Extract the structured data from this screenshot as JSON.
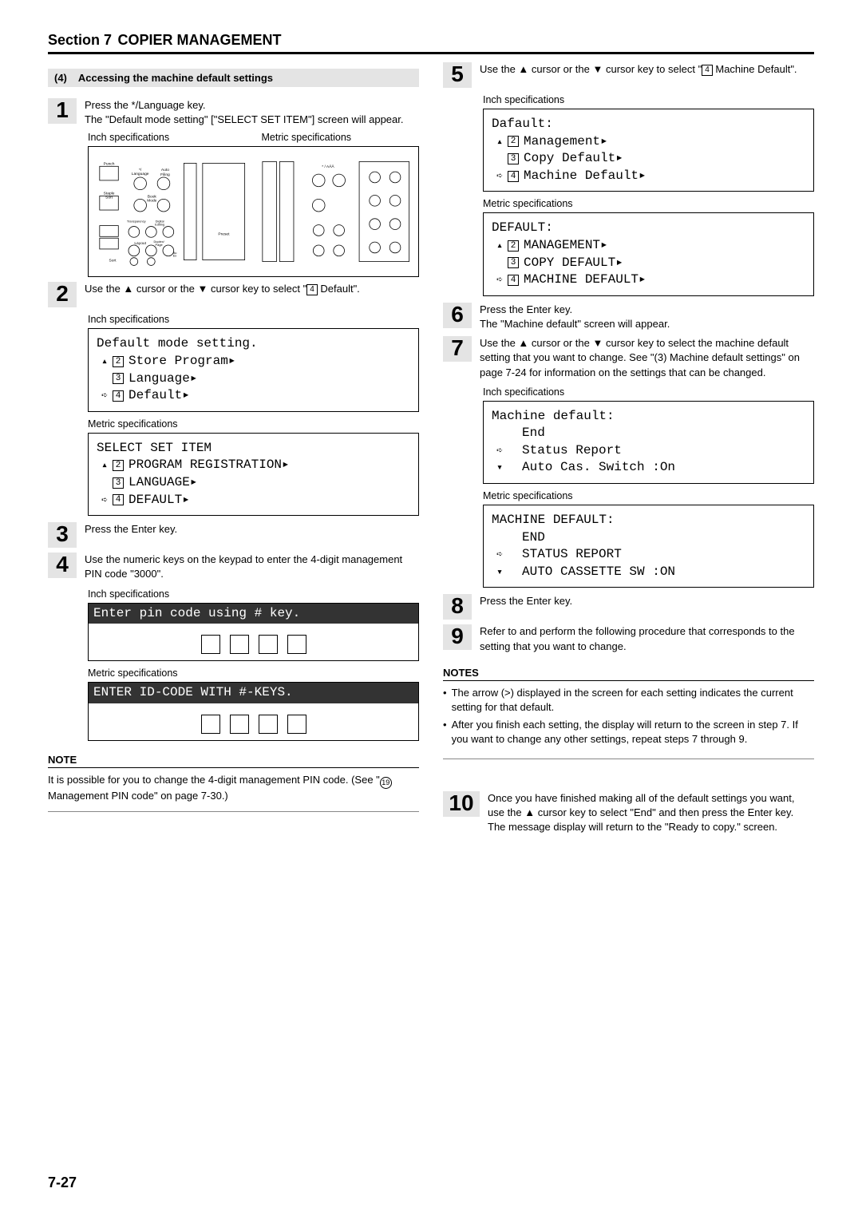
{
  "header": {
    "section_label": "Section 7",
    "section_title": "COPIER MANAGEMENT"
  },
  "subheading": {
    "num": "(4)",
    "text": "Accessing the machine default settings"
  },
  "inch_label": "Inch specifications",
  "metric_label": "Metric specifications",
  "steps": {
    "s1": {
      "num": "1",
      "l1": "Press the */Language key.",
      "l2": "The \"Default mode setting\" [\"SELECT SET ITEM\"] screen will appear."
    },
    "s2": {
      "num": "2",
      "text_a": "Use the ",
      "text_b": " cursor or the ",
      "text_c": " cursor key to select \"",
      "text_d": " Default\".",
      "box4": "4"
    },
    "s3": {
      "num": "3",
      "text": "Press the Enter key."
    },
    "s4": {
      "num": "4",
      "text": "Use the numeric keys on the keypad to enter the 4-digit management PIN code \"3000\"."
    },
    "s5": {
      "num": "5",
      "text_a": "Use the ",
      "text_b": " cursor or the ",
      "text_c": " cursor key to select \"",
      "text_d": " Machine Default\".",
      "box4": "4"
    },
    "s6": {
      "num": "6",
      "l1": "Press the Enter key.",
      "l2": "The \"Machine default\" screen will appear."
    },
    "s7": {
      "num": "7",
      "text_a": "Use the ",
      "text_b": " cursor or the ",
      "text_c": " cursor key to select the machine default setting that you want to change. See \"(3) Machine default settings\" on page 7-24 for information on the settings that can be changed."
    },
    "s8": {
      "num": "8",
      "text": "Press the Enter key."
    },
    "s9": {
      "num": "9",
      "text": "Refer to and perform the following procedure that corresponds to the setting that you want to change."
    },
    "s10": {
      "num": "10",
      "l1": "Once you have finished making all of the default settings you want, use the ",
      "l1b": " cursor key to select \"End\" and then press the Enter key.",
      "l2": "The message display will return to the \"Ready to copy.\" screen."
    }
  },
  "lcd": {
    "default_mode_inch": {
      "title": "Default mode setting.",
      "i2": "Store Program",
      "i3": "Language",
      "i4": "Default"
    },
    "default_mode_metric": {
      "title": "SELECT SET ITEM",
      "i2": "PROGRAM REGISTRATION",
      "i3": "LANGUAGE",
      "i4": "DEFAULT"
    },
    "pin_inch": "Enter pin code using # key.",
    "pin_metric": "ENTER ID-CODE WITH #-KEYS.",
    "def_inch": {
      "title": "Dafault:",
      "i2": "Management",
      "i3": "Copy Default",
      "i4": "Machine Default"
    },
    "def_metric": {
      "title": "DEFAULT:",
      "i2": "MANAGEMENT",
      "i3": "COPY DEFAULT",
      "i4": "MACHINE DEFAULT"
    },
    "mach_inch": {
      "title": "Machine default:",
      "i1": "End",
      "i2": "Status Report",
      "i3": "Auto Cas. Switch :On"
    },
    "mach_metric": {
      "title": "MACHINE DEFAULT:",
      "i1": "END",
      "i2": "STATUS REPORT",
      "i3": "AUTO CASSETTE SW :ON"
    }
  },
  "note1": {
    "heading": "NOTE",
    "text_a": "It is possible for you to change the 4-digit management PIN code. (See \"",
    "circle": "19",
    "text_b": " Management PIN code\" on page 7-30.)"
  },
  "notes2": {
    "heading": "NOTES",
    "b1": "The arrow (>) displayed in the screen for each setting indicates the current setting for that default.",
    "b2": "After you finish each setting, the display will return to the screen in step 7. If you want to change any other settings, repeat steps 7 through 9."
  },
  "panel_labels": {
    "punch": "Punch",
    "lang": "*/\nLanguage",
    "auto": "Auto\nSelection/\nFiling",
    "book": "Book\nMode",
    "staple": "Staple\nSort",
    "trans": "Transparency\nFilm/\nCard Stock",
    "digital": "Digital\nEditing",
    "preset": "Preset",
    "layout": "Layout",
    "duplex": "Duplex/\nPage\nSeparation",
    "auex": "Au\nEx",
    "sort": "Sort",
    "aaa": "* / AÄÂ"
  },
  "page_number": "7-27"
}
